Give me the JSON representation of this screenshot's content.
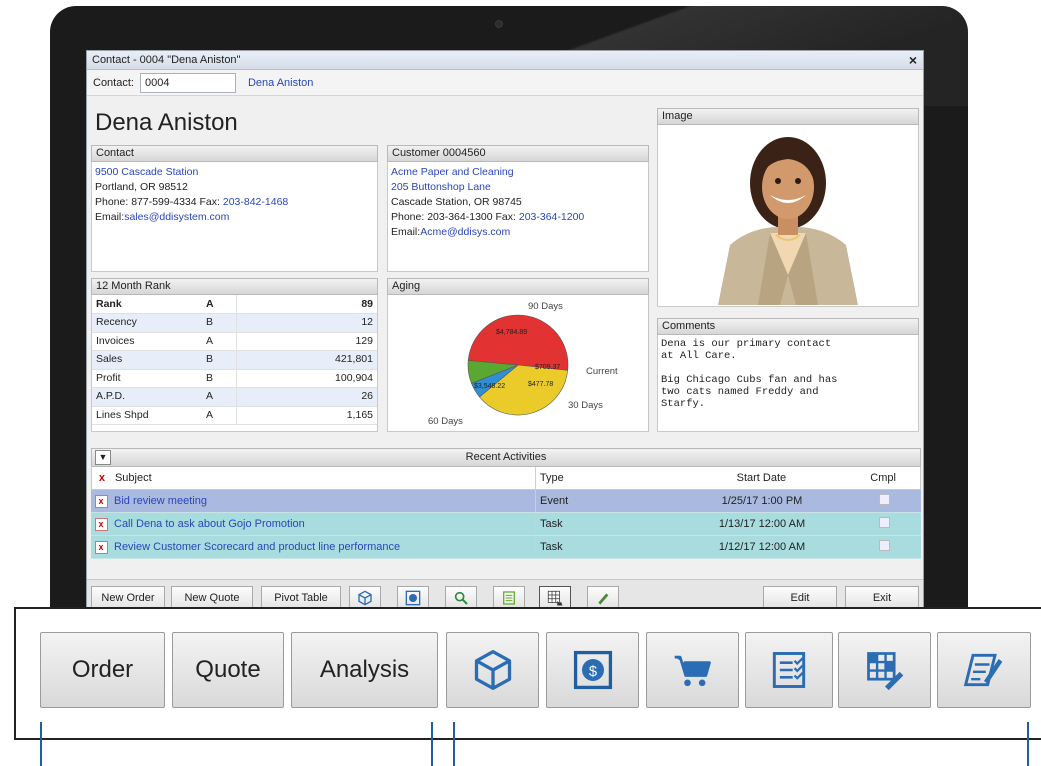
{
  "window": {
    "title": "Contact - 0004 \"Dena Aniston\"",
    "close_glyph": "×",
    "contact_label": "Contact:",
    "contact_id": "0004",
    "contact_name": "Dena Aniston"
  },
  "header": {
    "name": "Dena Aniston"
  },
  "contact_panel": {
    "title": "Contact",
    "address1": "9500 Cascade Station",
    "address2": "Portland, OR 98512",
    "phone_label": "Phone: 877-599-4334  Fax:",
    "fax": "203-842-1468",
    "email_label": "Email:",
    "email": "sales@ddisystem.com"
  },
  "customer_panel": {
    "title": "Customer 0004560",
    "company": "Acme Paper and Cleaning",
    "address1": "205 Buttonshop Lane",
    "address2": "Cascade Station, OR 98745",
    "phone_label": "Phone: 203-364-1300  Fax:",
    "fax": "203-364-1200",
    "email_label": "Email:",
    "email": "Acme@ddisys.com"
  },
  "image_panel": {
    "title": "Image"
  },
  "rank_panel": {
    "title": "12 Month Rank",
    "rows": [
      {
        "label": "Rank",
        "grade": "A",
        "value": "89"
      },
      {
        "label": "Recency",
        "grade": "B",
        "value": "12"
      },
      {
        "label": "Invoices",
        "grade": "A",
        "value": "129"
      },
      {
        "label": "Sales",
        "grade": "B",
        "value": "421,801"
      },
      {
        "label": "Profit",
        "grade": "B",
        "value": "100,904"
      },
      {
        "label": "A.P.D.",
        "grade": "A",
        "value": "26"
      },
      {
        "label": "Lines Shpd",
        "grade": "A",
        "value": "1,165"
      }
    ]
  },
  "aging_panel": {
    "title": "Aging",
    "labels": {
      "d90": "90 Days",
      "current": "Current",
      "d30": "30 Days",
      "d60": "60 Days"
    },
    "slice_values": {
      "d90": "$4,784.89",
      "d60": "$3,548.22",
      "current": "$709.37",
      "d30": "$477.78"
    }
  },
  "chart_data": {
    "type": "pie",
    "title": "Aging",
    "categories": [
      "90 Days",
      "60 Days",
      "30 Days",
      "Current"
    ],
    "values": [
      4784.89,
      3548.22,
      477.78,
      709.37
    ],
    "colors": [
      "#e33232",
      "#eacb2a",
      "#2f8fd6",
      "#5aa832"
    ]
  },
  "comments_panel": {
    "title": "Comments",
    "text": "Dena is our primary contact\nat All Care.\n\nBig Chicago Cubs fan and has\ntwo cats named Freddy and\nStarfy."
  },
  "recent": {
    "title": "Recent Activities",
    "filter_icon": "filter-icon",
    "columns": {
      "x": "x",
      "subject": "Subject",
      "type": "Type",
      "start": "Start Date",
      "cmpl": "Cmpl"
    },
    "rows": [
      {
        "subject": "Bid review meeting",
        "type": "Event",
        "start": "1/25/17 1:00 PM"
      },
      {
        "subject": "Call Dena to ask about Gojo Promotion",
        "type": "Task",
        "start": "1/13/17 12:00 AM"
      },
      {
        "subject": "Review Customer Scorecard and product line performance",
        "type": "Task",
        "start": "1/12/17 12:00 AM"
      }
    ]
  },
  "toolbar": {
    "new_order": "New Order",
    "new_quote": "New Quote",
    "pivot_table": "Pivot Table",
    "edit": "Edit",
    "exit": "Exit",
    "icons": [
      "cube-icon",
      "dollar-icon",
      "search-icon",
      "checklist-icon",
      "grid-edit-icon",
      "pen-note-icon"
    ]
  },
  "zoom_bar": {
    "order": "Order",
    "quote": "Quote",
    "analysis": "Analysis",
    "icons": [
      "cube-icon",
      "dollar-icon",
      "cart-icon",
      "checklist-icon",
      "grid-edit-icon",
      "pen-note-icon"
    ]
  }
}
